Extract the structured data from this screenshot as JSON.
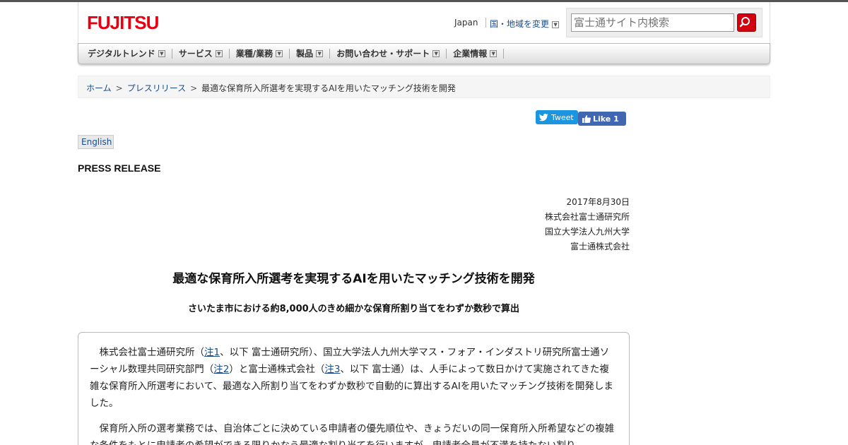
{
  "header": {
    "logo_text": "FUJITSU",
    "region": "Japan",
    "region_change": "国・地域を変更",
    "search_placeholder": "富士通サイト内検索"
  },
  "nav": {
    "items": [
      {
        "label": "デジタルトレンド"
      },
      {
        "label": "サービス"
      },
      {
        "label": "業種/業務"
      },
      {
        "label": "製品"
      },
      {
        "label": "お問い合わせ・サポート"
      },
      {
        "label": "企業情報"
      }
    ]
  },
  "breadcrumb": {
    "home": "ホーム",
    "press": "プレスリリース",
    "current": "最適な保育所入所選考を実現するAIを用いたマッチング技術を開発",
    "separator": ">"
  },
  "social": {
    "tweet": "Tweet",
    "like": "Like 1"
  },
  "language": {
    "english": "English"
  },
  "article": {
    "label": "PRESS RELEASE",
    "date": "2017年8月30日",
    "orgs": [
      "株式会社富士通研究所",
      "国立大学法人九州大学",
      "富士通株式会社"
    ],
    "title": "最適な保育所入所選考を実現するAIを用いたマッチング技術を開発",
    "subtitle": "さいたま市における約8,000人のきめ細かな保育所割り当てをわずか数秒で算出",
    "para1": {
      "t1": "株式会社富士通研究所（",
      "note1": "注1",
      "t2": "、以下 富士通研究所）、国立大学法人九州大学マス・フォア・インダストリ研究所富士通ソーシャル数理共同研究部門（",
      "note2": "注2",
      "t3": "）と富士通株式会社（",
      "note3": "注3",
      "t4": "、以下 富士通）は、人手によって数日かけて実施されてきた複雑な保育所入所選考において、最適な入所割り当てをわずか数秒で自動的に算出するAIを用いたマッチング技術を開発しました。"
    },
    "para2": "保育所入所の選考業務では、自治体ごとに決めている申請者の優先順位や、きょうだいの同一保育所入所希望などの複雑な条件をもとに申請者の希望ができる限りかなう最適な割り当てを行いますが、申請者全員が不満を持たない割り"
  },
  "colors": {
    "brand_red": "#e60012",
    "link_blue": "#1a4c8c",
    "tweet_blue": "#1b95e0",
    "facebook_blue": "#4267b2"
  }
}
